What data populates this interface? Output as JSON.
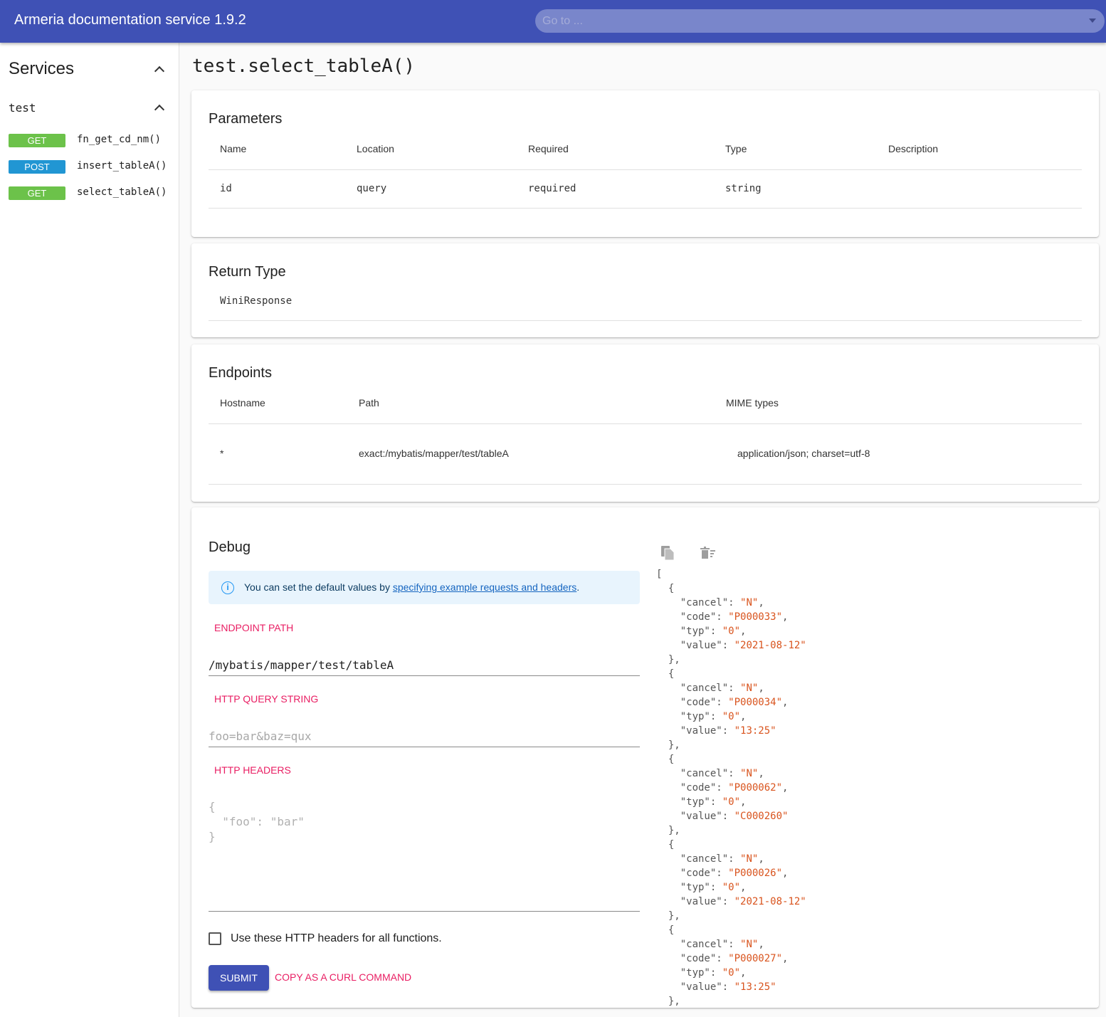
{
  "appbar": {
    "title": "Armeria documentation service 1.9.2",
    "goto_placeholder": "Go to ..."
  },
  "sidebar": {
    "heading": "Services",
    "group": "test",
    "items": [
      {
        "method": "GET",
        "name": "fn_get_cd_nm()"
      },
      {
        "method": "POST",
        "name": "insert_tableA()"
      },
      {
        "method": "GET",
        "name": "select_tableA()"
      }
    ]
  },
  "page_title": "test.select_tableA()",
  "parameters": {
    "heading": "Parameters",
    "columns": [
      "Name",
      "Location",
      "Required",
      "Type",
      "Description"
    ],
    "row": {
      "name": "id",
      "location": "query",
      "required": "required",
      "type": "string",
      "description": ""
    }
  },
  "return_type": {
    "heading": "Return Type",
    "value": "WiniResponse"
  },
  "endpoints": {
    "heading": "Endpoints",
    "columns": [
      "Hostname",
      "Path",
      "MIME types"
    ],
    "row": {
      "hostname": "*",
      "path": "exact:/mybatis/mapper/test/tableA",
      "mime": "application/json; charset=utf-8"
    }
  },
  "debug": {
    "heading": "Debug",
    "info_prefix": "You can set the default values by ",
    "info_link": "specifying example requests and headers",
    "info_suffix": ".",
    "endpoint_path_label": "ENDPOINT PATH",
    "endpoint_path_value": "/mybatis/mapper/test/tableA",
    "query_label": "HTTP QUERY STRING",
    "query_placeholder": "foo=bar&baz=qux",
    "headers_label": "HTTP HEADERS",
    "headers_placeholder": "{\n  \"foo\": \"bar\"\n}",
    "checkbox_label": "Use these HTTP headers for all functions.",
    "submit_label": "SUBMIT",
    "curl_label": "COPY AS A CURL COMMAND",
    "icons": [
      "copy-icon",
      "clear-icon"
    ]
  },
  "response": [
    {
      "cancel": "N",
      "code": "P000033",
      "typ": "0",
      "value": "2021-08-12"
    },
    {
      "cancel": "N",
      "code": "P000034",
      "typ": "0",
      "value": "13:25"
    },
    {
      "cancel": "N",
      "code": "P000062",
      "typ": "0",
      "value": "C000260"
    },
    {
      "cancel": "N",
      "code": "P000026",
      "typ": "0",
      "value": "2021-08-12"
    },
    {
      "cancel": "N",
      "code": "P000027",
      "typ": "0",
      "value": "13:25"
    }
  ],
  "colors": {
    "primary": "#3f51b5",
    "get": "#6cc24a",
    "post": "#2196d3",
    "accent": "#e91e63",
    "json_value": "#d9541e"
  }
}
